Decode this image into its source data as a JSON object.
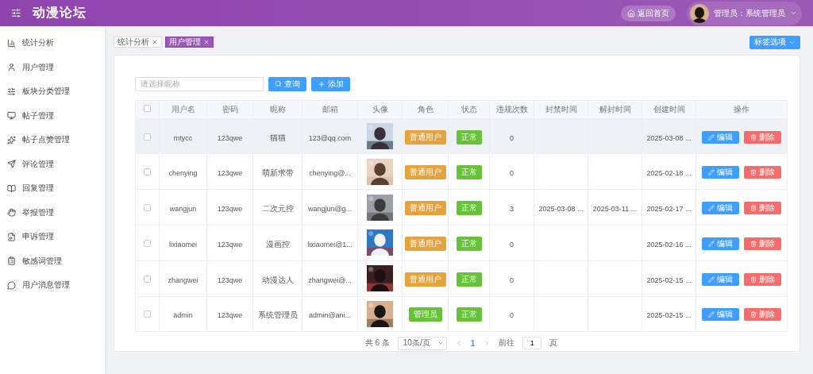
{
  "header": {
    "title": "动漫论坛",
    "home_button": "返回首页",
    "user_label": "管理员：系统管理员"
  },
  "sidebar": {
    "items": [
      {
        "label": "统计分析"
      },
      {
        "label": "用户管理"
      },
      {
        "label": "板块分类管理"
      },
      {
        "label": "帖子管理"
      },
      {
        "label": "帖子点赞管理"
      },
      {
        "label": "评论管理"
      },
      {
        "label": "回复管理"
      },
      {
        "label": "举报管理"
      },
      {
        "label": "申诉管理"
      },
      {
        "label": "敏感词管理"
      },
      {
        "label": "用户消息管理"
      }
    ]
  },
  "tabs": [
    {
      "label": "统计分析",
      "selected": false
    },
    {
      "label": "用户管理",
      "selected": true
    }
  ],
  "tab_options_button": "标签选项",
  "search": {
    "placeholder": "请选择昵称",
    "query_button": "查询",
    "add_button": "添加"
  },
  "table": {
    "select_all_checked": false,
    "columns": [
      "用户名",
      "密码",
      "昵称",
      "邮箱",
      "头像",
      "角色",
      "状态",
      "违规次数",
      "封禁时间",
      "解封时间",
      "创建时间",
      "操作"
    ],
    "rows": [
      {
        "hovered": true,
        "checked": false,
        "username": "mtycc",
        "password": "123qwe",
        "nickname": "猫猫",
        "email": "123@qq.com",
        "role": {
          "label": "普通用户",
          "kind": "user"
        },
        "status": "正常",
        "violations": "0",
        "created": "2025-03-08 ...",
        "edit": "编辑",
        "delete": "删除"
      },
      {
        "hovered": false,
        "checked": false,
        "username": "chenying",
        "password": "123qwe",
        "nickname": "萌新求带",
        "email": "chenying@...",
        "role": {
          "label": "普通用户",
          "kind": "user"
        },
        "status": "正常",
        "violations": "0",
        "created": "2025-02-18 ...",
        "edit": "编辑",
        "delete": "删除"
      },
      {
        "hovered": false,
        "checked": false,
        "username": "wangjun",
        "password": "123qwe",
        "nickname": "二次元控",
        "email": "wangjun@g...",
        "role": {
          "label": "普通用户",
          "kind": "user"
        },
        "status": "正常",
        "violations": "3",
        "ban_time": "2025-03-08 ...",
        "unban_time": "2025-03-11 ...",
        "created": "2025-02-17 ...",
        "edit": "编辑",
        "delete": "删除"
      },
      {
        "hovered": false,
        "checked": false,
        "username": "lixiaomei",
        "password": "123qwe",
        "nickname": "漫画控",
        "email": "lixiaomei@1...",
        "role": {
          "label": "普通用户",
          "kind": "user"
        },
        "status": "正常",
        "violations": "0",
        "created": "2025-02-16 ...",
        "edit": "编辑",
        "delete": "删除"
      },
      {
        "hovered": false,
        "checked": false,
        "username": "zhangwei",
        "password": "123qwe",
        "nickname": "动漫达人",
        "email": "zhangwei@...",
        "role": {
          "label": "普通用户",
          "kind": "user"
        },
        "status": "正常",
        "violations": "0",
        "created": "2025-02-15 ...",
        "edit": "编辑",
        "delete": "删除"
      },
      {
        "hovered": false,
        "checked": false,
        "username": "admin",
        "password": "123qwe",
        "nickname": "系统管理员",
        "email": "admin@ani...",
        "role": {
          "label": "管理员",
          "kind": "admin"
        },
        "status": "正常",
        "violations": "0",
        "created": "2025-02-15 ...",
        "edit": "编辑",
        "delete": "删除"
      }
    ]
  },
  "pagination": {
    "total": "共 6 条",
    "page_size": "10条/页",
    "pages": [
      {
        "label": "1",
        "selected": true
      }
    ],
    "goto_label": "前往",
    "goto_value": "1",
    "page_unit": "页"
  }
}
